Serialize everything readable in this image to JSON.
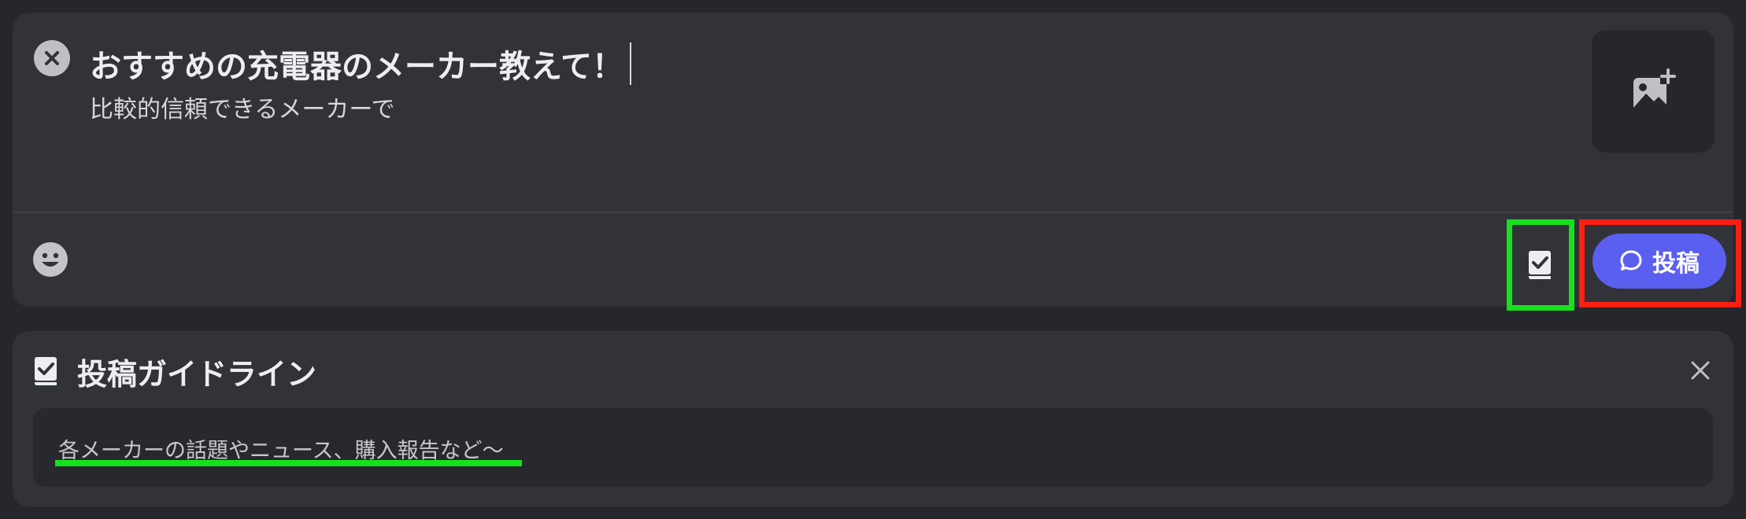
{
  "composer": {
    "title": "おすすめの充電器のメーカー教えて！",
    "body": "比較的信頼できるメーカーで",
    "post_label": "投稿"
  },
  "guideline": {
    "title": "投稿ガイドライン",
    "text": "各メーカーの話題やニュース、購入報告など〜"
  },
  "icons": {
    "clear": "close-circle-icon",
    "add_image": "image-add-icon",
    "emoji": "smiley-icon",
    "guideline": "checklist-book-icon",
    "post": "chat-bubble-icon",
    "dismiss": "close-icon"
  },
  "colors": {
    "accent": "#5b5ff0",
    "highlight_green": "#16e21b",
    "highlight_red": "#ff1e12"
  }
}
